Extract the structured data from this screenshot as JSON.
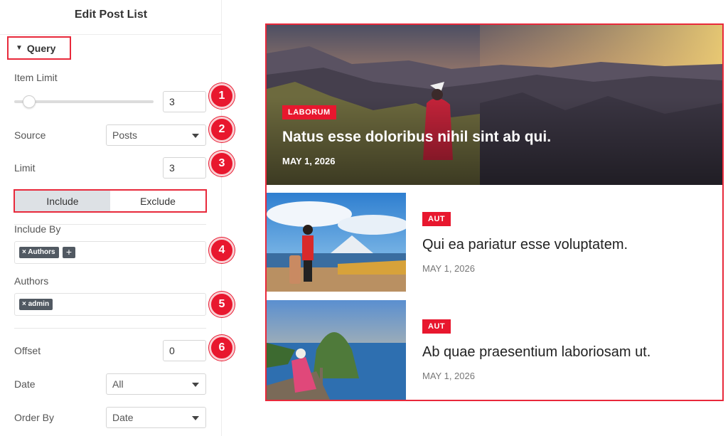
{
  "panel": {
    "title": "Edit Post List",
    "section": "Query",
    "item_limit": {
      "label": "Item Limit",
      "value": "3",
      "slider_fraction": 0.1
    },
    "source": {
      "label": "Source",
      "value": "Posts"
    },
    "limit": {
      "label": "Limit",
      "value": "3"
    },
    "tabs": [
      {
        "label": "Include",
        "active": true
      },
      {
        "label": "Exclude",
        "active": false
      }
    ],
    "include_by": {
      "label": "Include By",
      "tag": "× Authors",
      "add": "+"
    },
    "authors": {
      "label": "Authors",
      "tag": "× admin"
    },
    "offset": {
      "label": "Offset",
      "value": "0"
    },
    "date": {
      "label": "Date",
      "value": "All"
    },
    "order_by": {
      "label": "Order By",
      "value": "Date"
    }
  },
  "badges": [
    "1",
    "2",
    "3",
    "4",
    "5",
    "6"
  ],
  "preview": {
    "featured": {
      "category": "LABORUM",
      "title": "Natus esse doloribus nihil sint ab qui.",
      "date": "MAY 1, 2026"
    },
    "items": [
      {
        "category": "AUT",
        "title": "Qui ea pariatur esse voluptatem.",
        "date": "MAY 1, 2026"
      },
      {
        "category": "AUT",
        "title": "Ab quae praesentium laboriosam ut.",
        "date": "MAY 1, 2026"
      }
    ]
  },
  "colors": {
    "accent": "#e8172e",
    "highlight_border": "#e8293b",
    "tag": "#515962",
    "active_tab": "#dde1e5"
  }
}
